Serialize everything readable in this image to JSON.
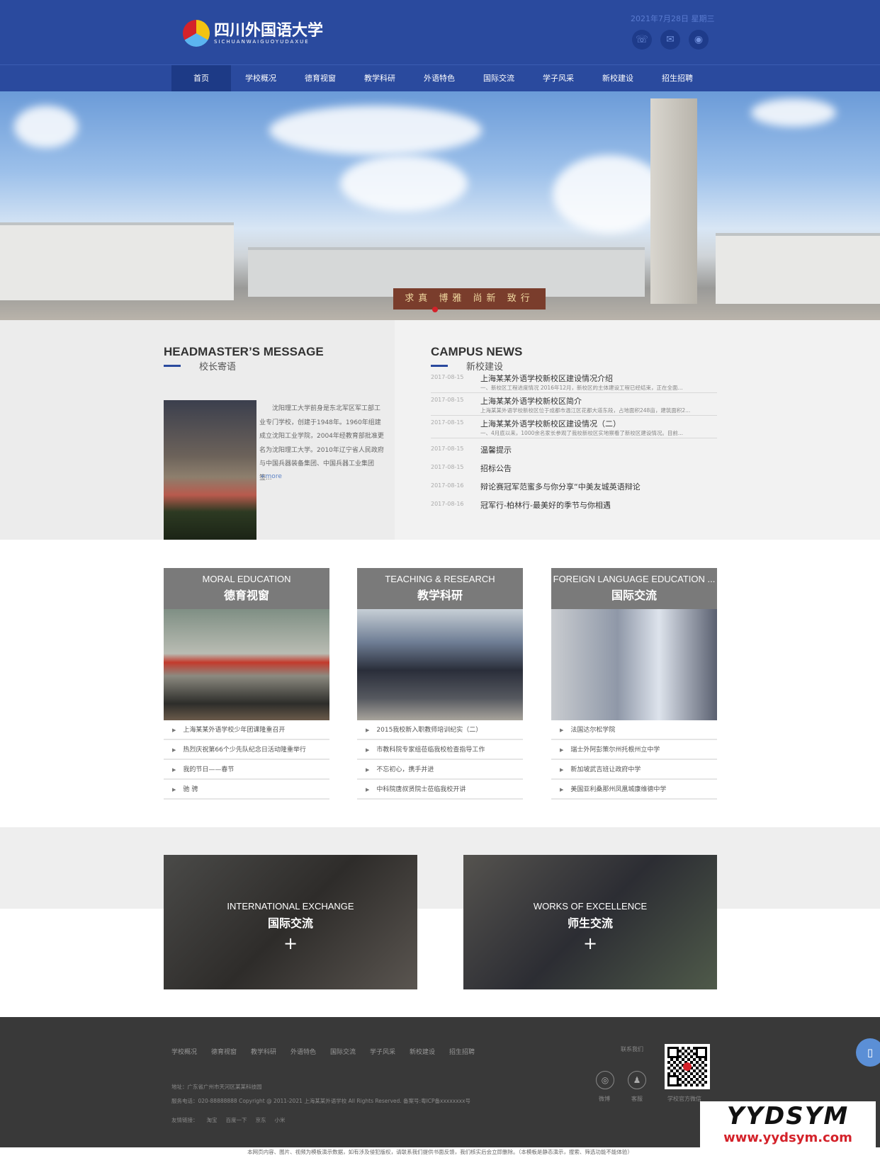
{
  "header": {
    "logo_cn": "四川外国语大学",
    "logo_en": "SICHUANWAIGUOYUDAXUE",
    "date": "2021年7月28日  星期三",
    "social_icons": [
      "phone-icon",
      "wechat-icon",
      "weibo-icon"
    ],
    "brand_color": "#2a4a9e"
  },
  "nav": {
    "items": [
      "首页",
      "学校概况",
      "德育视窗",
      "教学科研",
      "外语特色",
      "国际交流",
      "学子风采",
      "新校建设",
      "招生招聘"
    ],
    "active": "首页"
  },
  "banner": {
    "motto": "求真 博雅 尚新 致行",
    "active_slide": 1
  },
  "headmaster": {
    "title": "HEADMASTER’S MESSAGE",
    "subtitle": "校长寄语",
    "text": "沈阳理工大学前身是东北军区军工部工业专门学校，创建于1948年。1960年组建成立沈阳工业学院，2004年经教育部批准更名为沈阳理工大学。2010年辽宁省人民政府与中国兵器装备集团、中国兵器工业集团签...",
    "more": "+more"
  },
  "news": {
    "title": "CAMPUS NEWS",
    "subtitle": "新校建设",
    "featured": [
      {
        "date": "2017-08-15",
        "title": "上海某某外语学校新校区建设情况介绍",
        "desc": "一、新校区工程进度情况 2016年12月，新校区的主体建设工程已经结束，正在全面..."
      },
      {
        "date": "2017-08-15",
        "title": "上海某某外语学校新校区简介",
        "desc": "上海某某外语学校新校区位于成都市温江区花都大道东段，占地面积248亩，建筑面积2..."
      },
      {
        "date": "2017-08-15",
        "title": "上海某某外语学校新校区建设情况（二）",
        "desc": "一、4月底以来，1000余名家长参观了我校新校区实地察看了新校区建设情况。目前..."
      }
    ],
    "items": [
      {
        "date": "2017-08-15",
        "title": "温馨提示"
      },
      {
        "date": "2017-08-15",
        "title": "招标公告"
      },
      {
        "date": "2017-08-16",
        "title": "辩论赛冠军范蜜多与你分享“中美友城英语辩论"
      },
      {
        "date": "2017-08-16",
        "title": "冠军行-柏林行-最美好的季节与你相遇"
      }
    ]
  },
  "cards": [
    {
      "en": "MORAL EDUCATION",
      "cn": "德育视窗",
      "items": [
        "上海某某外语学校少年团课隆重召开",
        "热烈庆祝第66个少先队纪念日活动隆重举行",
        "我的节日——春节",
        "驰 骋"
      ]
    },
    {
      "en": "TEACHING & RESEARCH",
      "cn": "教学科研",
      "items": [
        "2015我校新入职教师培训纪实（二）",
        "市教科院专家组莅临我校检查指导工作",
        "不忘初心，携手并进",
        "中科院唐叔贤院士莅临我校开讲"
      ]
    },
    {
      "en": "FOREIGN LANGUAGE EDUCATION ...",
      "cn": "国际交流",
      "items": [
        "法国达尔松学院",
        "瑞士外阿彭策尔州托根州立中学",
        "新加坡武吉班让政府中学",
        "美国亚利桑那州凤凰城康维德中学"
      ]
    }
  ],
  "features": [
    {
      "en": "INTERNATIONAL EXCHANGE",
      "cn": "国际交流",
      "plus": "+"
    },
    {
      "en": "WORKS OF EXCELLENCE",
      "cn": "师生交流",
      "plus": "+"
    }
  ],
  "footer": {
    "links": [
      "学校概况",
      "德育视窗",
      "教学科研",
      "外语特色",
      "国际交流",
      "学子风采",
      "新校建设",
      "招生招聘"
    ],
    "address": "地址：广东省广州市天河区某某科技园",
    "copyright": "服务电话：020-88888888 Copyright @ 2011-2021 上海某某外语学校 All Rights Reserved.   备案号:粤ICP备xxxxxxxx号",
    "friend_label": "友情链接：",
    "friend_links": [
      "淘宝",
      "百度一下",
      "京东",
      "小米"
    ],
    "contact": "联系我们",
    "weibo": "微博",
    "service": "客服",
    "wechat": "学校官方微信",
    "disclaimer": "本网页内容、图片、视频为模板演示数据，如有涉及侵犯版权，请联系我们提供书面反馈，我们核实后会立即删除。（本模板是静态演示，搜索、筛选功能不能体验）"
  },
  "watermark": {
    "brand": "YYDSYM",
    "url": "www.yydsym.com"
  }
}
